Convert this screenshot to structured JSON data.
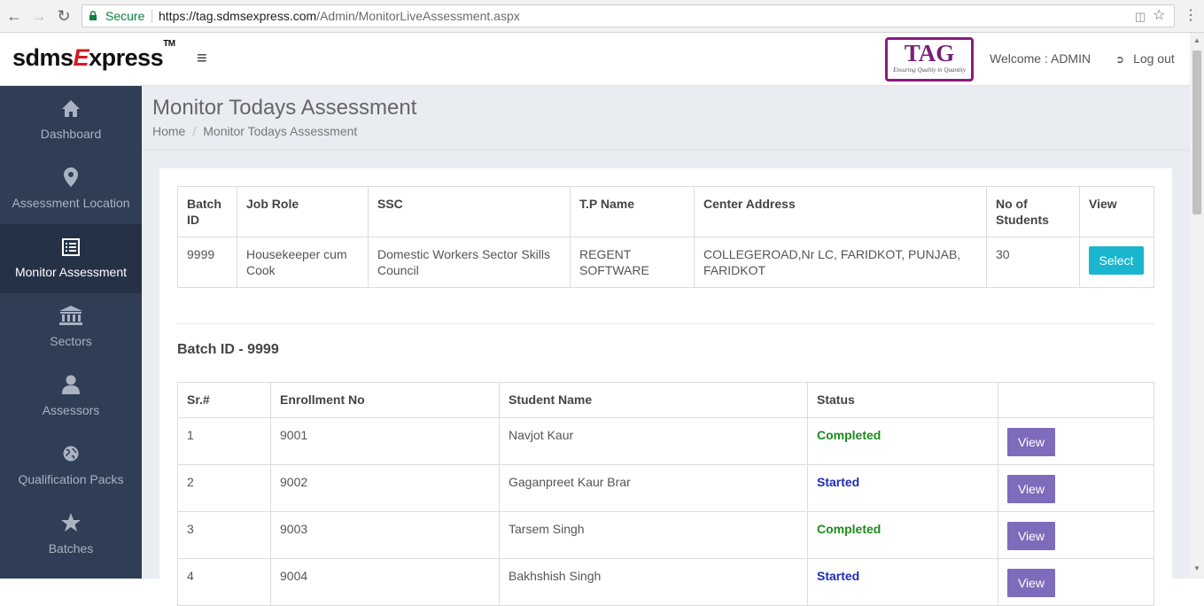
{
  "browser": {
    "secure_label": "Secure",
    "url_host": "https://tag.sdmsexpress.com",
    "url_path": "/Admin/MonitorLiveAssessment.aspx"
  },
  "header": {
    "logo_part1": "sdms",
    "logo_part2": "E",
    "logo_part3": "xpress",
    "logo_tm": "TM",
    "tag_logo_text": "TAG",
    "tag_logo_tagline": "Ensuring Quality in Quantity",
    "welcome_text": "Welcome : ADMIN",
    "logout_label": "Log out"
  },
  "sidebar": {
    "items": [
      {
        "label": "Dashboard",
        "icon": "home-icon"
      },
      {
        "label": "Assessment Location",
        "icon": "map-pin-icon"
      },
      {
        "label": "Monitor Assessment",
        "icon": "list-icon"
      },
      {
        "label": "Sectors",
        "icon": "bank-icon"
      },
      {
        "label": "Assessors",
        "icon": "user-icon"
      },
      {
        "label": "Qualification Packs",
        "icon": "globe-icon"
      },
      {
        "label": "Batches",
        "icon": "star-icon"
      }
    ]
  },
  "page": {
    "title": "Monitor Todays Assessment",
    "breadcrumb_home": "Home",
    "breadcrumb_current": "Monitor Todays Assessment"
  },
  "batch_table": {
    "headers": [
      "Batch ID",
      "Job Role",
      "SSC",
      "T.P Name",
      "Center Address",
      "No of Students",
      "View"
    ],
    "row": {
      "batch_id": "9999",
      "job_role": "Housekeeper cum Cook",
      "ssc": "Domestic Workers Sector Skills Council",
      "tp_name": "REGENT SOFTWARE",
      "center_address": "COLLEGEROAD,Nr LC, FARIDKOT, PUNJAB, FARIDKOT",
      "no_of_students": "30",
      "select_label": "Select"
    }
  },
  "batch_heading": "Batch ID - 9999",
  "student_table": {
    "headers": [
      "Sr.#",
      "Enrollment No",
      "Student Name",
      "Status",
      ""
    ],
    "rows": [
      {
        "sr": "1",
        "enrollment": "9001",
        "name": "Navjot Kaur",
        "status": "Completed",
        "view_label": "View"
      },
      {
        "sr": "2",
        "enrollment": "9002",
        "name": "Gaganpreet Kaur Brar",
        "status": "Started",
        "view_label": "View"
      },
      {
        "sr": "3",
        "enrollment": "9003",
        "name": "Tarsem Singh",
        "status": "Completed",
        "view_label": "View"
      },
      {
        "sr": "4",
        "enrollment": "9004",
        "name": "Bakhshish Singh",
        "status": "Started",
        "view_label": "View"
      }
    ]
  },
  "colors": {
    "sidebar_bg": "#2f3e55",
    "select_button": "#1ab5cf",
    "view_button": "#7e6bbb",
    "completed": "#1e8a1e",
    "started": "#1f2bb8"
  }
}
